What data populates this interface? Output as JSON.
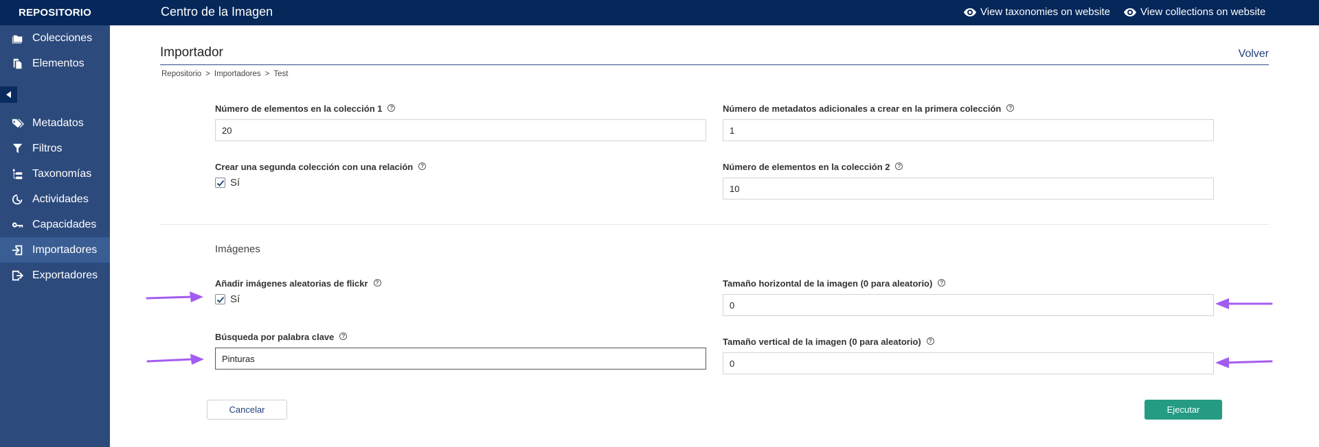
{
  "sidebar": {
    "brand": "REPOSITORIO",
    "items_top": [
      {
        "label": "Colecciones",
        "icon": "folder-icon"
      },
      {
        "label": "Elementos",
        "icon": "files-icon"
      }
    ],
    "items_bottom": [
      {
        "label": "Metadatos",
        "icon": "tags-icon"
      },
      {
        "label": "Filtros",
        "icon": "filter-icon"
      },
      {
        "label": "Taxonomías",
        "icon": "taxonomy-icon"
      },
      {
        "label": "Actividades",
        "icon": "activity-icon"
      },
      {
        "label": "Capacidades",
        "icon": "key-icon"
      },
      {
        "label": "Importadores",
        "icon": "import-icon",
        "active": true
      },
      {
        "label": "Exportadores",
        "icon": "export-icon"
      }
    ]
  },
  "topbar": {
    "title": "Centro de la Imagen",
    "link_taxonomies": "View taxonomies on website",
    "link_collections": "View collections on website"
  },
  "page": {
    "title": "Importador",
    "back": "Volver",
    "breadcrumb": [
      "Repositorio",
      "Importadores",
      "Test"
    ],
    "breadcrumb_sep": ">"
  },
  "form": {
    "items_col1_label": "Número de elementos en la colección 1",
    "items_col1_value": "20",
    "extra_metadata_label": "Número de metadatos adicionales a crear en la primera colección",
    "extra_metadata_value": "1",
    "second_collection_label": "Crear una segunda colección con una relación",
    "second_collection_check": "Sí",
    "items_col2_label": "Número de elementos en la colección 2",
    "items_col2_value": "10",
    "images_section": "Imágenes",
    "flickr_label": "Añadir imágenes aleatorias de flickr",
    "flickr_check": "Sí",
    "width_label": "Tamaño horizontal de la imagen (0 para aleatorio)",
    "width_value": "0",
    "keyword_label": "Búsqueda por palabra clave",
    "keyword_value": "Pinturas",
    "height_label": "Tamaño vertical de la imagen (0 para aleatorio)",
    "height_value": "0",
    "help_glyph": "?"
  },
  "buttons": {
    "cancel": "Cancelar",
    "run": "Ejecutar"
  },
  "colors": {
    "topbar": "#05275a",
    "sidebar": "#2c4a7c",
    "run_button": "#259b84",
    "annotation_arrow": "#a35cf0"
  }
}
